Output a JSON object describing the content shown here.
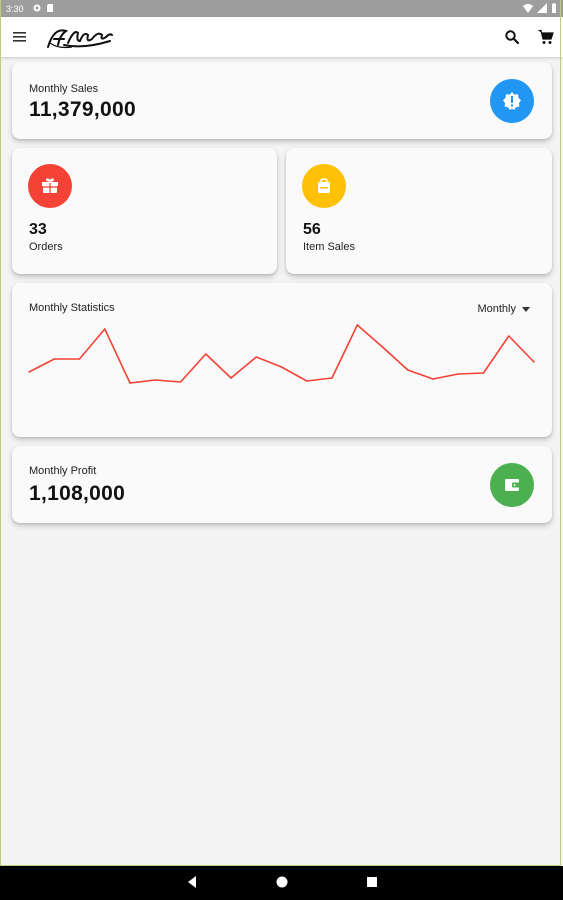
{
  "status_bar": {
    "time": "3:30"
  },
  "app_bar": {
    "logo_text": "Ahcoi"
  },
  "cards": {
    "monthly_sales": {
      "label": "Monthly Sales",
      "value": "11,379,000",
      "icon": "alert-circle-icon",
      "color": "#2196F3"
    },
    "orders": {
      "value": "33",
      "label": "Orders",
      "icon": "gift-icon",
      "color": "#F44336"
    },
    "item_sales": {
      "value": "56",
      "label": "Item Sales",
      "icon": "box-icon",
      "color": "#FFC107"
    },
    "monthly_statistics": {
      "title": "Monthly Statistics",
      "filter": "Monthly"
    },
    "monthly_profit": {
      "label": "Monthly Profit",
      "value": "1,108,000",
      "icon": "wallet-icon",
      "color": "#4CAF50"
    }
  },
  "chart_data": {
    "type": "line",
    "title": "Monthly Statistics",
    "series": [
      {
        "color": "#F44336",
        "values": [
          26,
          39,
          39,
          69,
          15,
          18,
          16,
          44,
          20,
          41,
          31,
          17,
          20,
          73,
          51,
          28,
          19,
          24,
          25,
          62,
          36
        ]
      }
    ],
    "ylim": [
      0,
      80
    ],
    "grid": false,
    "axes_visible": false
  }
}
